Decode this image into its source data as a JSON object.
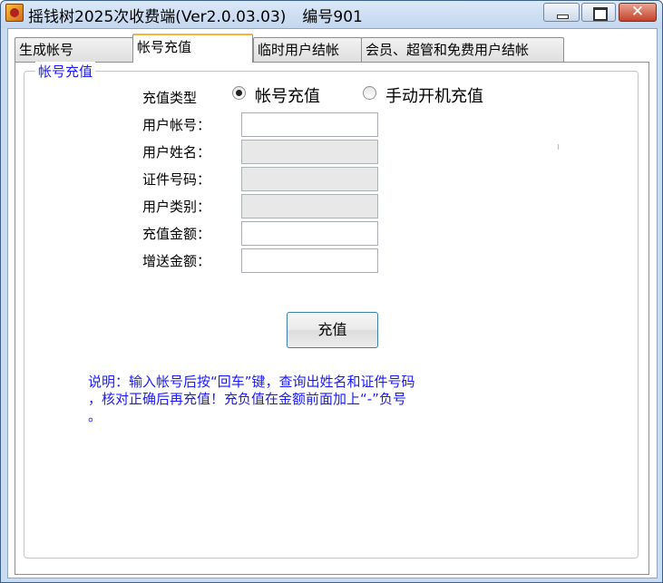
{
  "window": {
    "title": "摇钱树2025次收费端(Ver2.0.03.03)",
    "id_label": "编号901",
    "controls": {
      "minimize": "",
      "maximize": "",
      "close": "✕"
    }
  },
  "tabs": [
    {
      "label": "生成帐号",
      "active": false
    },
    {
      "label": "帐号充值",
      "active": true
    },
    {
      "label": "临时用户结帐",
      "active": false
    },
    {
      "label": "会员、超管和免费用户结帐",
      "active": false
    }
  ],
  "group": {
    "legend": "帐号充值",
    "recharge_type_label": "充值类型",
    "radio_options": [
      {
        "label": "帐号充值",
        "checked": true
      },
      {
        "label": "手动开机充值",
        "checked": false
      }
    ],
    "fields": [
      {
        "label": "用户帐号：",
        "value": "",
        "enabled": true
      },
      {
        "label": "用户姓名：",
        "value": "",
        "enabled": false
      },
      {
        "label": "证件号码：",
        "value": "",
        "enabled": false
      },
      {
        "label": "用户类别：",
        "value": "",
        "enabled": false
      },
      {
        "label": "充值金额：",
        "value": "",
        "enabled": true
      },
      {
        "label": "增送金额：",
        "value": "",
        "enabled": true
      }
    ],
    "submit_label": "充值",
    "note_lines": [
      "说明：输入帐号后按“回车”键，查询出姓名和证件号码",
      "，核对正确后再充值！充负值在金额前面加上“-”负号",
      "。"
    ]
  },
  "colors": {
    "legend_text": "#1a1aff",
    "note_text": "#1a1aff",
    "active_tab_accent": "#f3b43b",
    "title_bar": "#c3d7ef"
  }
}
